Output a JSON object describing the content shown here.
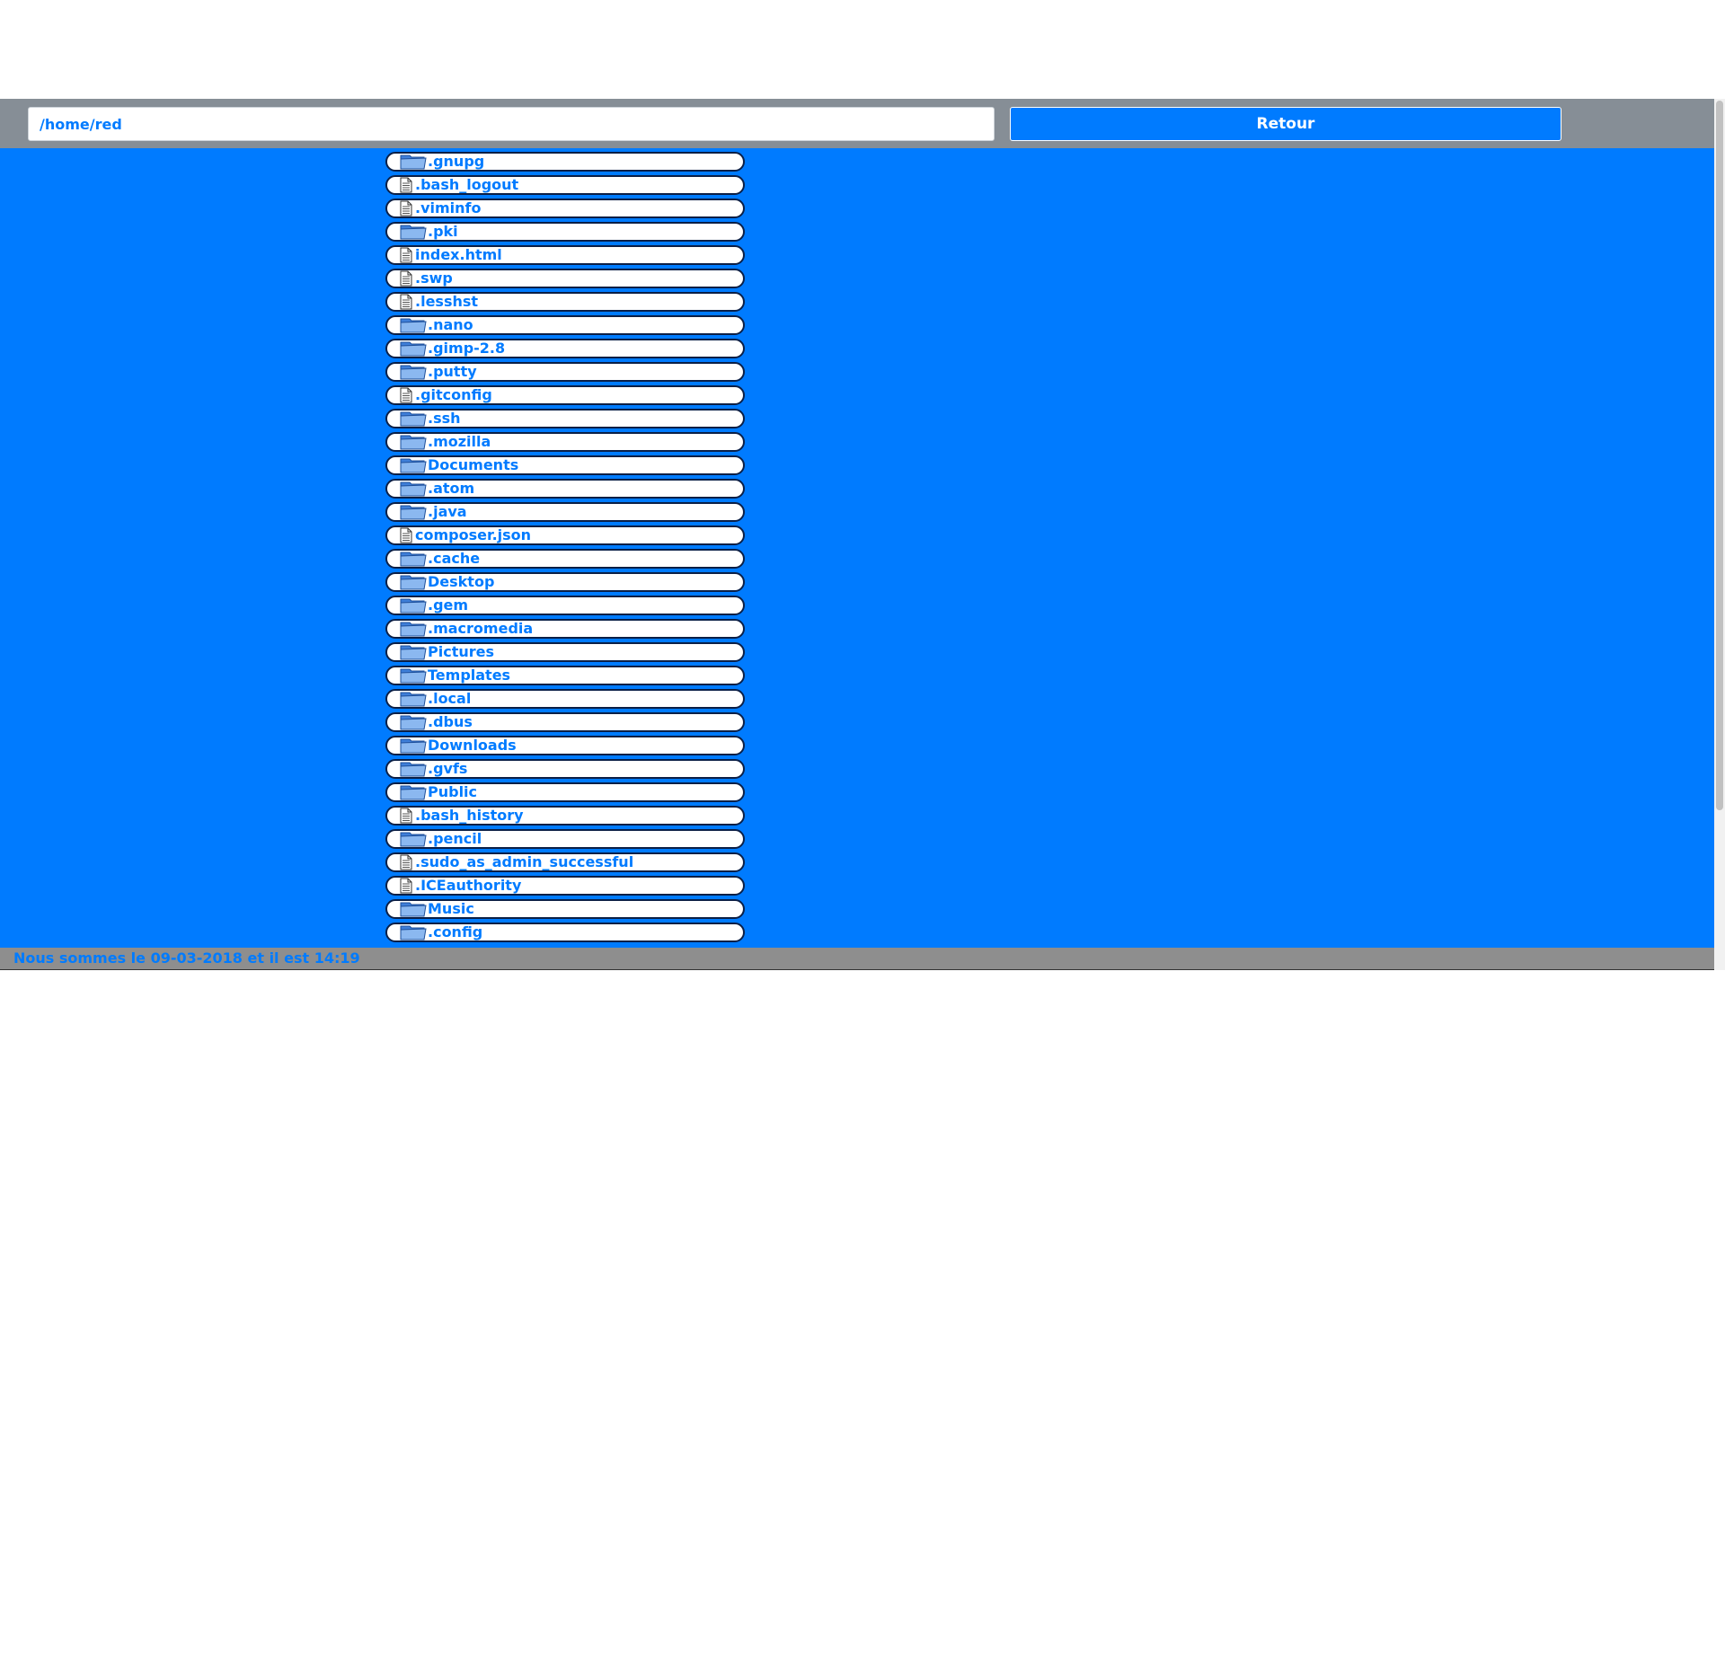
{
  "header": {
    "path_value": "/home/red",
    "back_label": "Retour"
  },
  "colors": {
    "accent": "#007bff",
    "header_bg": "#868e96",
    "footer_bg": "#8e8e8e",
    "entry_border": "#0b1f46"
  },
  "icons": {
    "folder": "folder-icon",
    "file": "file-icon"
  },
  "entries": [
    {
      "name": ".gnupg",
      "type": "folder"
    },
    {
      "name": ".bash_logout",
      "type": "file"
    },
    {
      "name": ".viminfo",
      "type": "file"
    },
    {
      "name": ".pki",
      "type": "folder"
    },
    {
      "name": "index.html",
      "type": "file"
    },
    {
      "name": ".swp",
      "type": "file"
    },
    {
      "name": ".lesshst",
      "type": "file"
    },
    {
      "name": ".nano",
      "type": "folder"
    },
    {
      "name": ".gimp-2.8",
      "type": "folder"
    },
    {
      "name": ".putty",
      "type": "folder"
    },
    {
      "name": ".gitconfig",
      "type": "file"
    },
    {
      "name": ".ssh",
      "type": "folder"
    },
    {
      "name": ".mozilla",
      "type": "folder"
    },
    {
      "name": "Documents",
      "type": "folder"
    },
    {
      "name": ".atom",
      "type": "folder"
    },
    {
      "name": ".java",
      "type": "folder"
    },
    {
      "name": "composer.json",
      "type": "file"
    },
    {
      "name": ".cache",
      "type": "folder"
    },
    {
      "name": "Desktop",
      "type": "folder"
    },
    {
      "name": ".gem",
      "type": "folder"
    },
    {
      "name": ".macromedia",
      "type": "folder"
    },
    {
      "name": "Pictures",
      "type": "folder"
    },
    {
      "name": "Templates",
      "type": "folder"
    },
    {
      "name": ".local",
      "type": "folder"
    },
    {
      "name": ".dbus",
      "type": "folder"
    },
    {
      "name": "Downloads",
      "type": "folder"
    },
    {
      "name": ".gvfs",
      "type": "folder"
    },
    {
      "name": "Public",
      "type": "folder"
    },
    {
      "name": ".bash_history",
      "type": "file"
    },
    {
      "name": ".pencil",
      "type": "folder"
    },
    {
      "name": ".sudo_as_admin_successful",
      "type": "file"
    },
    {
      "name": ".ICEauthority",
      "type": "file"
    },
    {
      "name": "Music",
      "type": "folder"
    },
    {
      "name": ".config",
      "type": "folder"
    }
  ],
  "footer": {
    "status_text": "Nous sommes le 09-03-2018 et il est 14:19"
  }
}
